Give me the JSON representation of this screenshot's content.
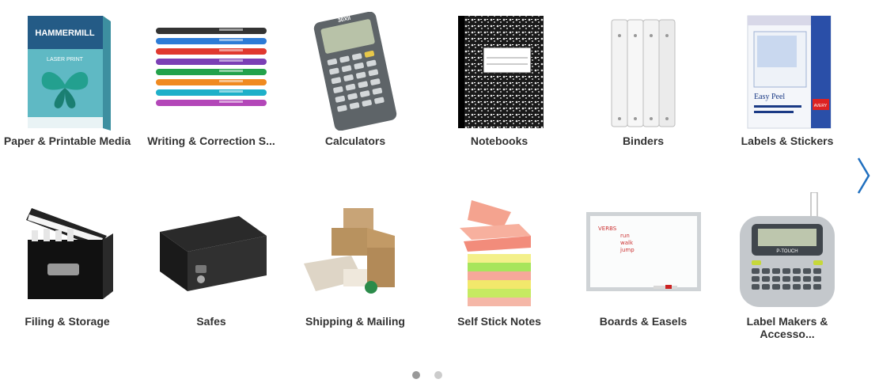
{
  "carousel": {
    "items": [
      {
        "label": "Paper & Printable Media",
        "icon": "paper-ream-icon",
        "brand": "HAMMERMILL",
        "subtext": "LASER PRINT"
      },
      {
        "label": "Writing & Correction S...",
        "icon": "pens-icon"
      },
      {
        "label": "Calculators",
        "icon": "calculator-icon",
        "model": "30XII"
      },
      {
        "label": "Notebooks",
        "icon": "notebook-icon"
      },
      {
        "label": "Binders",
        "icon": "binders-icon"
      },
      {
        "label": "Labels & Stickers",
        "icon": "labels-box-icon",
        "brand": "AVERY",
        "subtext": "Easy Peel"
      },
      {
        "label": "Filing & Storage",
        "icon": "file-box-icon"
      },
      {
        "label": "Safes",
        "icon": "safe-icon"
      },
      {
        "label": "Shipping & Mailing",
        "icon": "shipping-boxes-icon"
      },
      {
        "label": "Self Stick Notes",
        "icon": "sticky-notes-icon"
      },
      {
        "label": "Boards & Easels",
        "icon": "whiteboard-icon",
        "board_text": "VERBS\nrun\nwalk\njump"
      },
      {
        "label": "Label Makers & Accesso...",
        "icon": "label-maker-icon",
        "brand": "P-TOUCH"
      }
    ],
    "pages": 2,
    "active_page": 1
  },
  "colors": {
    "text": "#333333",
    "arrow": "#1f6fbf",
    "dot_active": "#999999",
    "dot": "#cccccc"
  }
}
